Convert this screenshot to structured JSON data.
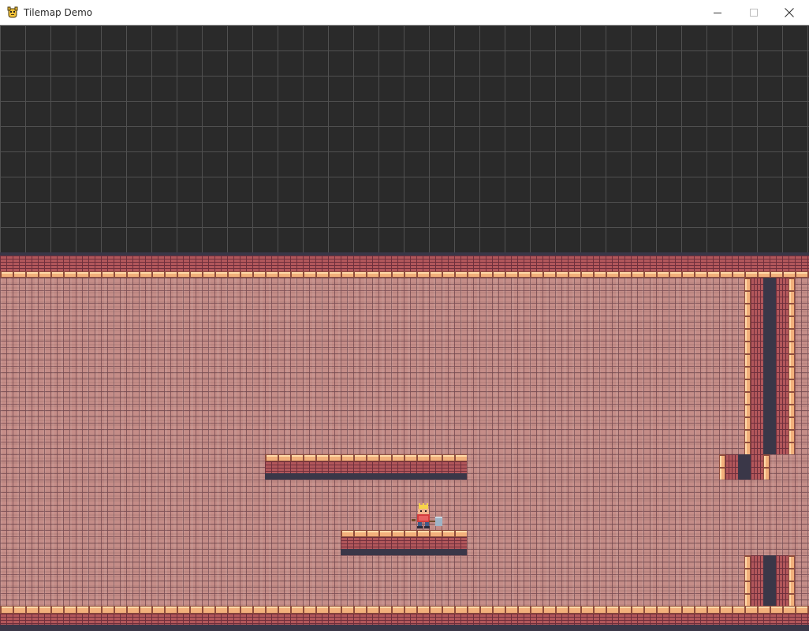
{
  "window": {
    "title": "Tilemap Demo",
    "app_icon": "pygame-snake-icon",
    "controls": [
      "minimize-icon",
      "maximize-icon",
      "close-icon"
    ]
  },
  "scene": {
    "background_grid_color": "#2a2a2a",
    "grid_line_color": "#505050",
    "wall_color": "#c58d88",
    "plank_color": "#f2b07b",
    "shadow_color": "#3a3748",
    "player": "king-with-hammer-sprite"
  }
}
